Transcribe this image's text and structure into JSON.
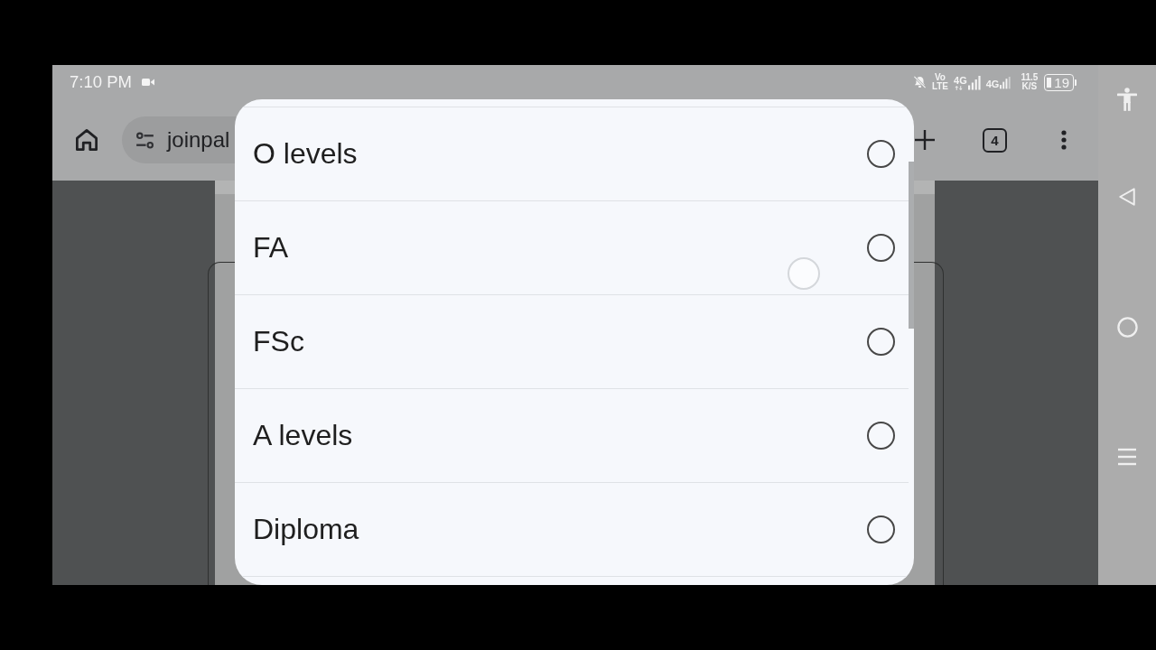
{
  "status_bar": {
    "time": "7:10 PM",
    "volte": "Vo LTE",
    "sim_1_network": "4G",
    "sim_2_network": "4G",
    "speed": "11.5 K/S",
    "battery": "19"
  },
  "toolbar": {
    "url": "joinpal",
    "tab_count": "4"
  },
  "dialog": {
    "options": [
      {
        "label": "O levels",
        "selected": false
      },
      {
        "label": "FA",
        "selected": false
      },
      {
        "label": "FSc",
        "selected": false
      },
      {
        "label": "A levels",
        "selected": false
      },
      {
        "label": "Diploma",
        "selected": false
      }
    ]
  }
}
